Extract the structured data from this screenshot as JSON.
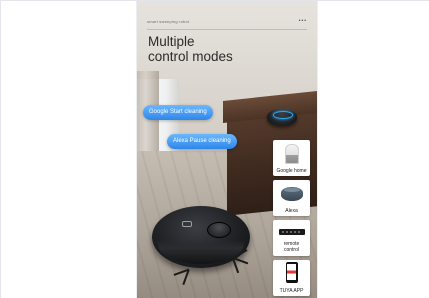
{
  "poster": {
    "topbar_left": "smart sweeping robot",
    "topbar_right": "•••",
    "title_line1": "Multiple",
    "title_line2": "control modes"
  },
  "voice_bubbles": [
    {
      "text": "Google Start cleaning"
    },
    {
      "text": "Alexa Pause cleaning"
    }
  ],
  "control_cards": [
    {
      "label": "Google home",
      "icon": "google-home-speaker-icon"
    },
    {
      "label": "Alexa",
      "icon": "alexa-echo-icon"
    },
    {
      "label_line1": "remote",
      "label_line2": "control",
      "icon": "remote-control-icon"
    },
    {
      "label": "TUYA APP",
      "icon": "phone-app-icon"
    }
  ],
  "colors": {
    "bubble_blue": "#2f86e8",
    "echo_ring": "#2aa9f2",
    "app_accent": "#e53935"
  }
}
